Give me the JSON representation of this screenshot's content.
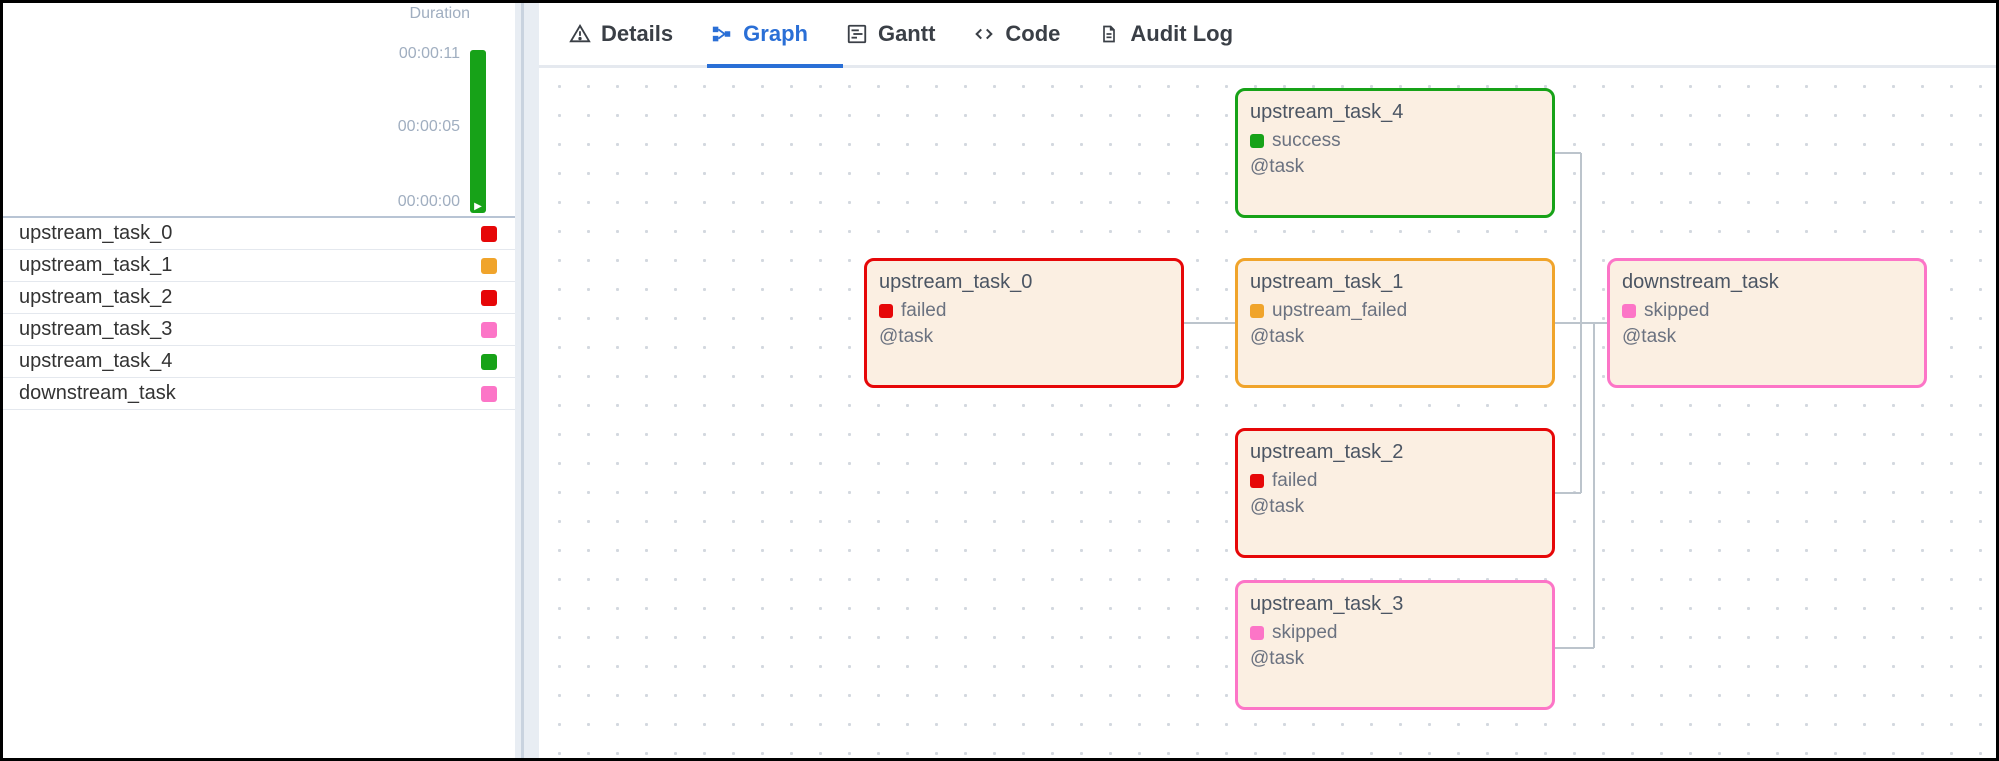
{
  "sidebar": {
    "duration_label": "Duration",
    "axis": {
      "t0": "00:00:00",
      "t1": "00:00:05",
      "t2": "00:00:11"
    },
    "tasks": [
      {
        "label": "upstream_task_0",
        "chip": "red"
      },
      {
        "label": "upstream_task_1",
        "chip": "orange"
      },
      {
        "label": "upstream_task_2",
        "chip": "red"
      },
      {
        "label": "upstream_task_3",
        "chip": "pink"
      },
      {
        "label": "upstream_task_4",
        "chip": "green"
      },
      {
        "label": "downstream_task",
        "chip": "pink"
      }
    ]
  },
  "tabs": {
    "details": "Details",
    "graph": "Graph",
    "gantt": "Gantt",
    "code": "Code",
    "audit": "Audit Log"
  },
  "nodes": {
    "u0": {
      "title": "upstream_task_0",
      "status": "failed",
      "meta": "@task",
      "color": "red"
    },
    "u1": {
      "title": "upstream_task_1",
      "status": "upstream_failed",
      "meta": "@task",
      "color": "orange"
    },
    "u2": {
      "title": "upstream_task_2",
      "status": "failed",
      "meta": "@task",
      "color": "red"
    },
    "u3": {
      "title": "upstream_task_3",
      "status": "skipped",
      "meta": "@task",
      "color": "pink"
    },
    "u4": {
      "title": "upstream_task_4",
      "status": "success",
      "meta": "@task",
      "color": "green"
    },
    "dn": {
      "title": "downstream_task",
      "status": "skipped",
      "meta": "@task",
      "color": "pink"
    }
  }
}
